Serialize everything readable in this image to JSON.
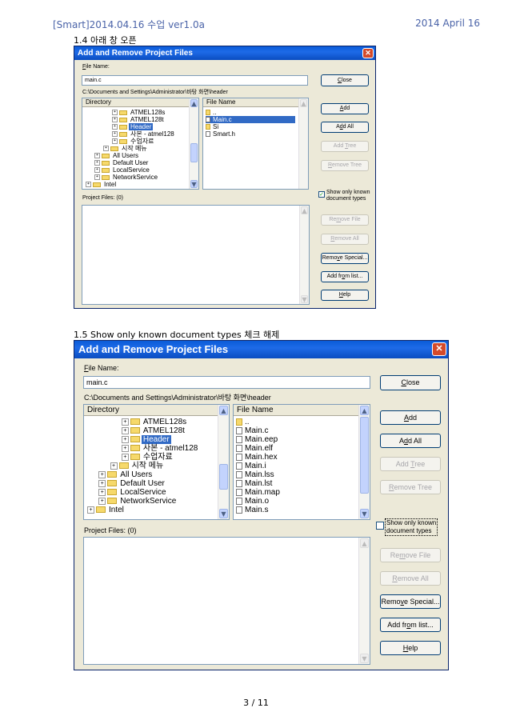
{
  "page": {
    "header_left": "[Smart]2014.04.16 수업 ver1.0a",
    "header_right": "2014 April 16",
    "section1": "1.4 아래 창 오픈",
    "section2": "1.5 Show only known document types 체크 해제",
    "footer": "3 / 11"
  },
  "dialog": {
    "title": "Add and Remove Project Files",
    "file_name_label": "File Name:",
    "file_name_value": "main.c",
    "path": "C:\\Documents and Settings\\Administrator\\바탕 화면\\header",
    "directory_header": "Directory",
    "file_header": "File Name",
    "project_files_label": "Project Files: (0)",
    "show_known_label_1": "Show only known",
    "show_known_label_2": "document types",
    "buttons": {
      "close": "Close",
      "add": "Add",
      "add_all": "Add All",
      "add_tree": "Add Tree",
      "remove_tree": "Remove Tree",
      "remove_file": "Remove File",
      "remove_all": "Remove All",
      "remove_special": "Remove Special...",
      "add_from_list": "Add from list...",
      "help": "Help"
    },
    "directory_items": [
      "ATMEL128s",
      "ATMEL128t",
      "Header",
      "사본 - atmel128",
      "수업자료",
      "시작 메뉴",
      "All Users",
      "Default User",
      "LocalService",
      "NetworkService",
      "Intel"
    ],
    "files_dialog1": [
      "..",
      "Main.c",
      "Si",
      "Smart.h"
    ],
    "files_dialog2": [
      "..",
      "Main.c",
      "Main.eep",
      "Main.elf",
      "Main.hex",
      "Main.i",
      "Main.lss",
      "Main.lst",
      "Main.map",
      "Main.o",
      "Main.s"
    ]
  },
  "dialog1_state": {
    "show_known_checked": true
  },
  "dialog2_state": {
    "show_known_checked": false
  }
}
